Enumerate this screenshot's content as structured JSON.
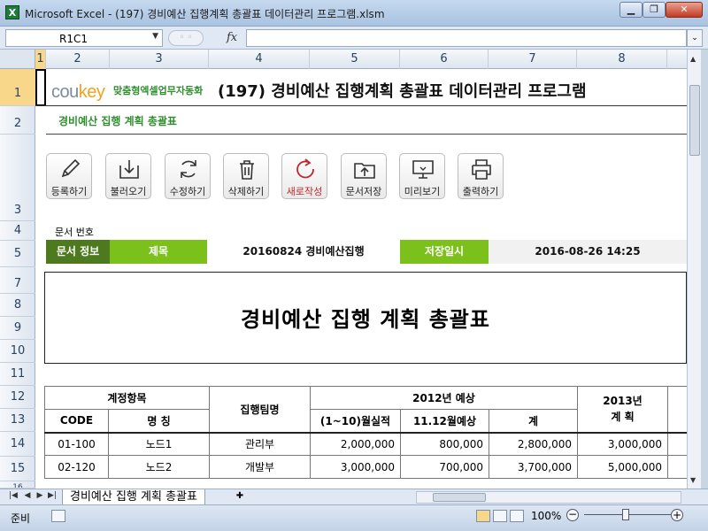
{
  "window": {
    "title": "Microsoft Excel - (197) 경비예산 집행계획 총괄표 데이터관리 프로그램.xlsm",
    "min_label": "▁",
    "max_label": "❐",
    "close_label": "✕"
  },
  "formula_bar": {
    "name_box": "R1C1",
    "fx": "fx",
    "formula": ""
  },
  "columns": [
    "1",
    "2",
    "3",
    "4",
    "5",
    "6",
    "7",
    "8"
  ],
  "rows": [
    "1",
    "2",
    "3",
    "4",
    "5",
    "7",
    "8",
    "9",
    "10",
    "11",
    "12",
    "13",
    "14",
    "15",
    "16"
  ],
  "header": {
    "logo_main": "cou",
    "logo_accent": "key",
    "logo_sub": "맞춤형엑셀업무자동화",
    "title": "(197) 경비예산 집행계획 총괄표 데이터관리 프로그램",
    "subtitle": "경비예산 집행 계획 총괄표"
  },
  "toolbar": {
    "register": "등록하기",
    "load": "불러오기",
    "edit": "수정하기",
    "delete": "삭제하기",
    "new": "새로작성",
    "save_doc": "문서저장",
    "preview": "미리보기",
    "print": "출력하기"
  },
  "doc_info": {
    "doc_no_label": "문서 번호",
    "doc_info_label": "문서 정보",
    "title_label": "제목",
    "title_value": "20160824 경비예산집행",
    "saved_label": "저장일시",
    "saved_value": "2016-08-26 14:25"
  },
  "report": {
    "title": "경비예산 집행 계획 총괄표"
  },
  "table": {
    "h_item": "계정항목",
    "h_team": "집행팀명",
    "h_2012": "2012년 예상",
    "h_2013": "2013년\n계  획",
    "h_code": "CODE",
    "h_name": "명    칭",
    "h_actual": "(1~10)월실적",
    "h_forecast": "11.12월예상",
    "h_sum": "계",
    "rows": [
      {
        "code": "01-100",
        "name": "노드1",
        "team": "관리부",
        "actual": "2,000,000",
        "forecast": "800,000",
        "sum": "2,800,000",
        "plan": "3,000,000"
      },
      {
        "code": "02-120",
        "name": "노드2",
        "team": "개발부",
        "actual": "3,000,000",
        "forecast": "700,000",
        "sum": "3,700,000",
        "plan": "5,000,000"
      }
    ]
  },
  "sheet_tab": "경비예산 집행 계획 총괄표",
  "status": {
    "ready": "준비",
    "zoom": "100%",
    "zoom_percent": 100
  }
}
